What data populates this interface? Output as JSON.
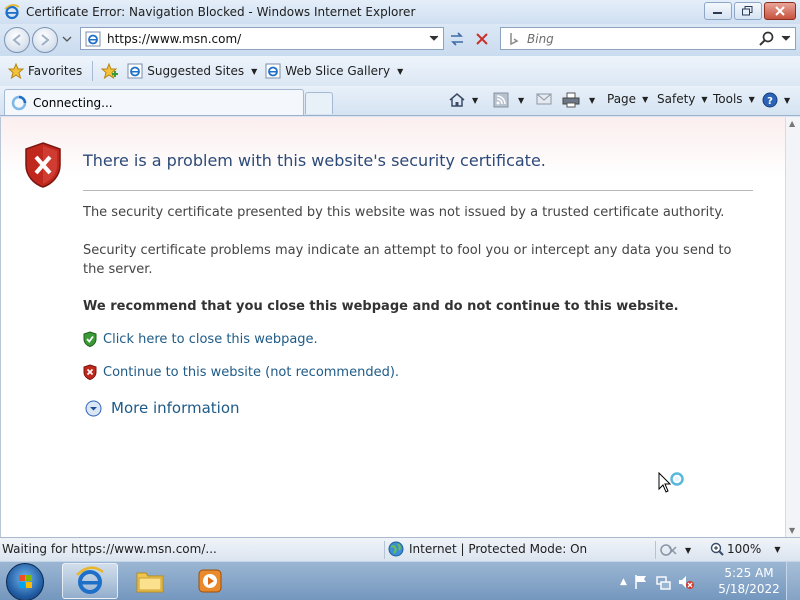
{
  "window": {
    "title": "Certificate Error: Navigation Blocked - Windows Internet Explorer"
  },
  "address_bar": {
    "url": "https://www.msn.com/"
  },
  "search": {
    "placeholder": "Bing"
  },
  "favorites_bar": {
    "favorites_label": "Favorites",
    "items": [
      {
        "label": "Suggested Sites"
      },
      {
        "label": "Web Slice Gallery"
      }
    ]
  },
  "tab": {
    "label": "Connecting..."
  },
  "command_bar": {
    "page": "Page",
    "safety": "Safety",
    "tools": "Tools"
  },
  "page": {
    "heading": "There is a problem with this website's security certificate.",
    "para1": "The security certificate presented by this website was not issued by a trusted certificate authority.",
    "para2": "Security certificate problems may indicate an attempt to fool you or intercept any data you send to the server.",
    "recommend": "We recommend that you close this webpage and do not continue to this website.",
    "close_link": "Click here to close this webpage.",
    "continue_link": "Continue to this website (not recommended).",
    "more_info": "More information"
  },
  "status_bar": {
    "status": "Waiting for https://www.msn.com/...",
    "zone": "Internet | Protected Mode: On",
    "zoom": "100%"
  },
  "taskbar": {
    "time": "5:25 AM",
    "date": "5/18/2022"
  },
  "colors": {
    "link": "#1f5b87",
    "heading": "#2c4a78",
    "error_red": "#c0281e",
    "safe_green": "#3a9a35"
  }
}
